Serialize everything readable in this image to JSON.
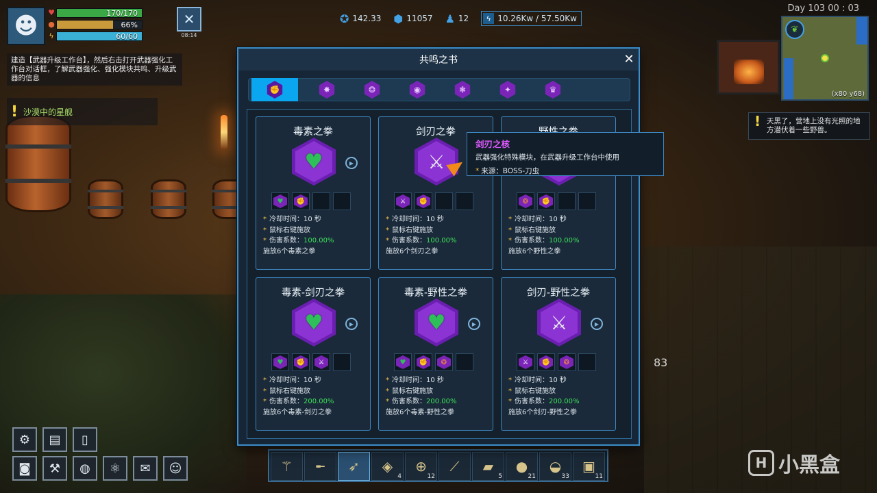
{
  "hud": {
    "health": {
      "text": "170/170",
      "fraction": 1.0,
      "color": "#3aa845"
    },
    "hunger": {
      "text": "66%",
      "fraction": 0.66,
      "color": "#c99a3a"
    },
    "energy": {
      "text": "60/60",
      "fraction": 1.0,
      "color": "#3ab0d6"
    },
    "tool_time": "08:14",
    "quest_text": "建造【武器升级工作台】，然后右击打开武器强化工作台对话框，了解武器强化、强化模块共鸣、升级武器的信息",
    "quest_title": "沙漠中的星舰",
    "stats": {
      "research": "142.33",
      "coins": "11057",
      "population": "12",
      "power": "10.26Kw / 57.50Kw"
    },
    "day": "Day 103 00 : 03",
    "minimap_coords": "(x80 y68)",
    "notice": "天黑了，营地上没有光照的地方潜伏着一些野兽。",
    "floating_number": "83"
  },
  "dialog": {
    "title": "共鸣之书",
    "close": "✕",
    "tabs": [
      {
        "icon": "fist-swirl-icon",
        "glyph": "✊",
        "active": true
      },
      {
        "icon": "burst-icon",
        "glyph": "✸",
        "active": false
      },
      {
        "icon": "beast-icon",
        "glyph": "❂",
        "active": false
      },
      {
        "icon": "orb-icon",
        "glyph": "◉",
        "active": false
      },
      {
        "icon": "brain-icon",
        "glyph": "❃",
        "active": false
      },
      {
        "icon": "fire-icon",
        "glyph": "✦",
        "active": false
      },
      {
        "icon": "crown-icon",
        "glyph": "♛",
        "active": false
      }
    ],
    "cards": [
      {
        "title": "毒素之拳",
        "icon": "poison-heart-icon",
        "glyph": "♥",
        "glyph_class": "heart",
        "slots": [
          "poison-heart-icon",
          "fist-swirl-icon"
        ],
        "cooldown": "冷却时间：10 秒",
        "trigger": "鼠标右键施放",
        "damage_label": "伤害系数：",
        "damage": "100.00%",
        "cast": "施放6个毒素之拳"
      },
      {
        "title": "剑刃之拳",
        "icon": "crossed-blades-icon",
        "glyph": "⚔",
        "glyph_class": "blade",
        "slots": [
          "crossed-blades-icon",
          "fist-swirl-icon"
        ],
        "cooldown": "冷却时间：10 秒",
        "trigger": "鼠标右键施放",
        "damage_label": "伤害系数：",
        "damage": "100.00%",
        "cast": "施放6个剑刃之拳"
      },
      {
        "title": "野性之拳",
        "icon": "beast-icon",
        "glyph": "❂",
        "glyph_class": "heart",
        "slots": [
          "beast-icon",
          "fist-swirl-icon"
        ],
        "cooldown": "冷却时间：10 秒",
        "trigger": "鼠标右键施放",
        "damage_label": "伤害系数：",
        "damage": "100.00%",
        "cast": "施放6个野性之拳"
      },
      {
        "title": "毒素-剑刃之拳",
        "icon": "poison-heart-icon",
        "glyph": "♥",
        "glyph_class": "heart",
        "slots": [
          "poison-heart-icon",
          "fist-swirl-icon",
          "crossed-blades-icon"
        ],
        "cooldown": "冷却时间：10 秒",
        "trigger": "鼠标右键施放",
        "damage_label": "伤害系数：",
        "damage": "200.00%",
        "cast": "施放6个毒素-剑刃之拳"
      },
      {
        "title": "毒素-野性之拳",
        "icon": "poison-heart-icon",
        "glyph": "♥",
        "glyph_class": "heart",
        "slots": [
          "poison-heart-icon",
          "fist-swirl-icon",
          "beast-icon"
        ],
        "cooldown": "冷却时间：10 秒",
        "trigger": "鼠标右键施放",
        "damage_label": "伤害系数：",
        "damage": "200.00%",
        "cast": "施放6个毒素-野性之拳"
      },
      {
        "title": "剑刃-野性之拳",
        "icon": "crossed-blades-icon",
        "glyph": "⚔",
        "glyph_class": "blade",
        "slots": [
          "crossed-blades-icon",
          "fist-swirl-icon",
          "beast-icon"
        ],
        "cooldown": "冷却时间：10 秒",
        "trigger": "鼠标右键施放",
        "damage_label": "伤害系数：",
        "damage": "200.00%",
        "cast": "施放6个剑刃-野性之拳"
      }
    ],
    "tooltip": {
      "title": "剑刃之核",
      "desc": "武器强化特殊模块，在武器升级工作台中使用",
      "source": "来源：BOSS-刀虫"
    }
  },
  "menu": [
    {
      "name": "settings-gear-icon",
      "glyph": "⚙"
    },
    {
      "name": "book-icon",
      "glyph": "▤"
    },
    {
      "name": "walkie-talkie-icon",
      "glyph": "▯"
    },
    {
      "name": "backpack-icon",
      "glyph": "◙"
    },
    {
      "name": "anvil-icon",
      "glyph": "⚒"
    },
    {
      "name": "globe-icon",
      "glyph": "◍"
    },
    {
      "name": "atom-icon",
      "glyph": "⚛"
    },
    {
      "name": "mail-icon",
      "glyph": "✉"
    },
    {
      "name": "people-icon",
      "glyph": "☺"
    }
  ],
  "hotbar": [
    {
      "name": "staff-icon",
      "glyph": "⚚",
      "count": ""
    },
    {
      "name": "rifle-icon",
      "glyph": "╾",
      "count": ""
    },
    {
      "name": "drill-gun-icon",
      "glyph": "➶",
      "count": "",
      "active": true
    },
    {
      "name": "lantern-icon",
      "glyph": "◈",
      "count": "4"
    },
    {
      "name": "turret-icon",
      "glyph": "⊕",
      "count": "12"
    },
    {
      "name": "syringe-icon",
      "glyph": "⟋",
      "count": ""
    },
    {
      "name": "canister-icon",
      "glyph": "▰",
      "count": "5"
    },
    {
      "name": "cookie-icon",
      "glyph": "●",
      "count": "21"
    },
    {
      "name": "bowl-icon",
      "glyph": "◒",
      "count": "33"
    },
    {
      "name": "robot-icon",
      "glyph": "▣",
      "count": "11"
    }
  ],
  "watermark": {
    "text": "小黑盒",
    "logo": "H"
  }
}
